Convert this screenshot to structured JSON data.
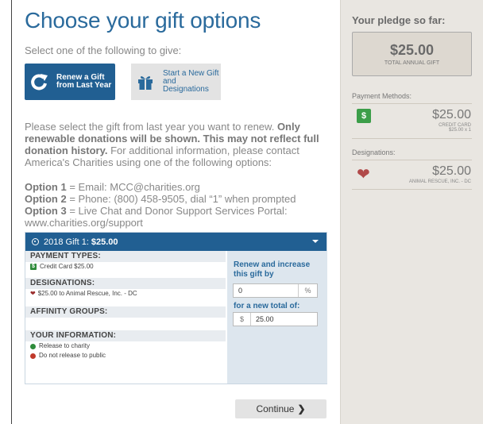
{
  "main": {
    "title": "Choose your gift options",
    "subtitle": "Select one of the following to give:",
    "renew_button": "Renew a Gift from Last Year",
    "new_button": "Start a New Gift and Designations",
    "info_plain_1": "Please select the gift from last year you want to renew. ",
    "info_bold": "Only renewable donations will be shown. This may not reflect full donation history.",
    "info_plain_2": " For additional information, please contact America's Charities using one of the following options:",
    "options": [
      {
        "label": "Option 1",
        "text": " = Email: MCC@charities.org"
      },
      {
        "label": "Option 2",
        "text": " = Phone: (800) 458-9505, dial “1” when prompted"
      },
      {
        "label": "Option 3",
        "text": " = Live Chat and Donor Support Services Portal: www.charities.org/support"
      }
    ],
    "continue_label": "Continue"
  },
  "gift": {
    "header_prefix": "2018 Gift 1: ",
    "header_amount": "$25.00",
    "payment_types_head": "PAYMENT TYPES:",
    "payment_line": "Credit Card $25.00",
    "designations_head": "DESIGNATIONS:",
    "designation_line": "$25.00 to Animal Rescue, Inc. - DC",
    "affinity_head": "AFFINITY GROUPS:",
    "your_info_head": "YOUR INFORMATION:",
    "release_charity": "Release to charity",
    "no_release_public": "Do not release to public",
    "renew_label": "Renew and increase this gift by",
    "increase_value": "0",
    "percent_unit": "%",
    "new_total_label": "for a new total of:",
    "currency_symbol": "$",
    "new_total_value": "25.00"
  },
  "sidebar": {
    "title": "Your pledge so far:",
    "total_value": "$25.00",
    "total_label": "TOTAL ANNUAL GIFT",
    "payment_methods_label": "Payment Methods:",
    "payment_amount": "$25.00",
    "payment_sub1": "CREDIT CARD",
    "payment_sub2": "$25.00 x 1",
    "designations_label": "Designations:",
    "designation_amount": "$25.00",
    "designation_sub": "ANIMAL RESCUE, INC. - DC"
  },
  "colors": {
    "primary_blue": "#215f92",
    "title_blue": "#2a6a9c",
    "sidebar_bg": "#e9e6e1",
    "success_green": "#2e8b3a",
    "heart_red": "#b14a4a"
  },
  "icons": {
    "renew": "refresh-icon",
    "new_gift": "gift-icon",
    "dollar": "dollar-icon",
    "heart": "heart-icon"
  }
}
